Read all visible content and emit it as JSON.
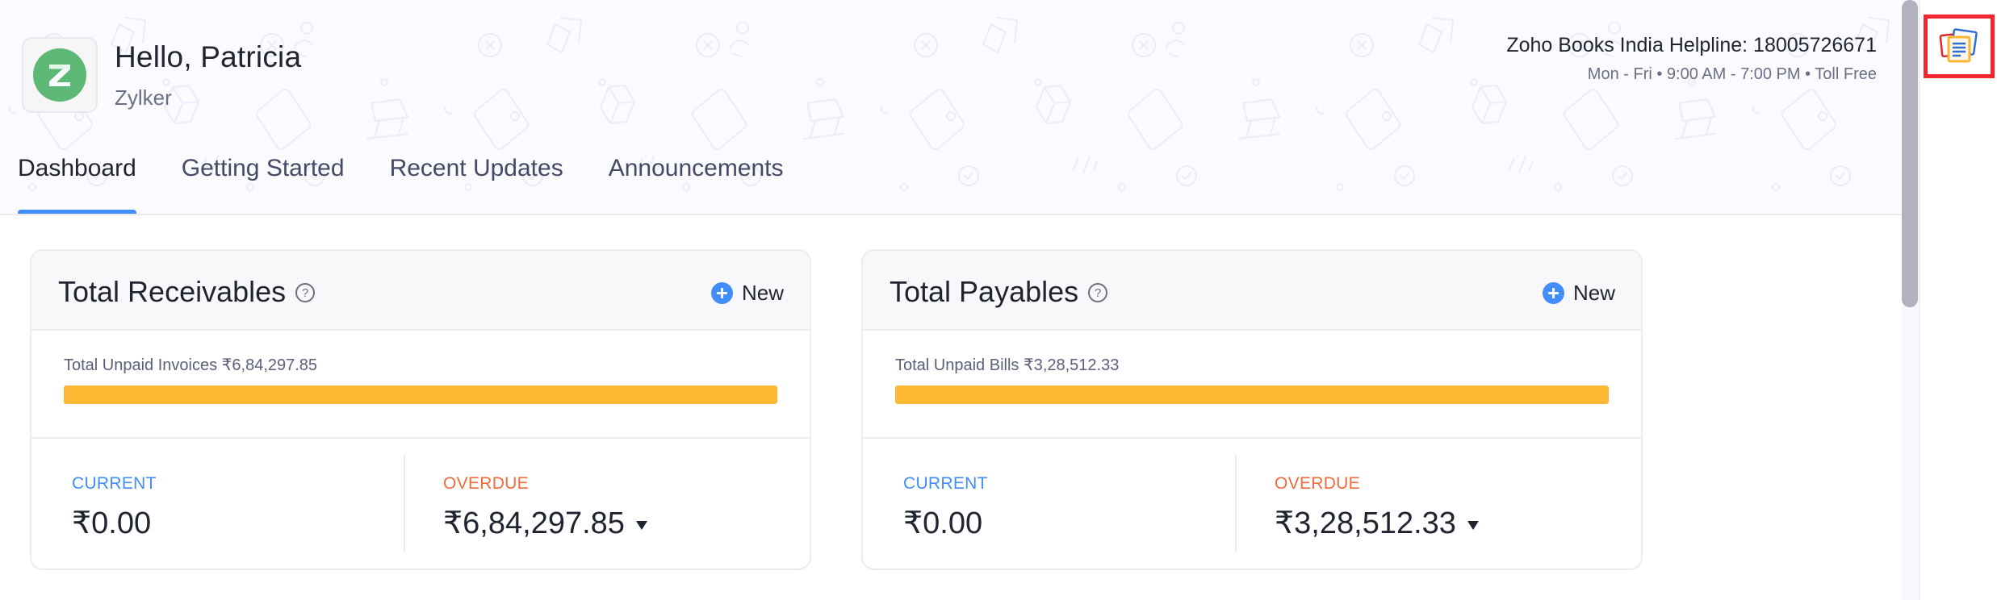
{
  "header": {
    "greeting": "Hello, Patricia",
    "organization": "Zylker",
    "logo_letter": "Z",
    "helpline_title": "Zoho Books India Helpline: 18005726671",
    "helpline_hours": "Mon - Fri • 9:00 AM - 7:00 PM • Toll Free"
  },
  "tabs": [
    {
      "label": "Dashboard",
      "active": true
    },
    {
      "label": "Getting Started",
      "active": false
    },
    {
      "label": "Recent Updates",
      "active": false
    },
    {
      "label": "Announcements",
      "active": false
    }
  ],
  "cards": {
    "receivables": {
      "title": "Total Receivables",
      "help_glyph": "?",
      "new_label": "New",
      "unpaid_text": "Total Unpaid Invoices ₹6,84,297.85",
      "overdue_fraction": 1.0,
      "current_label": "CURRENT",
      "current_amount": "₹0.00",
      "overdue_label": "OVERDUE",
      "overdue_amount": "₹6,84,297.85"
    },
    "payables": {
      "title": "Total Payables",
      "help_glyph": "?",
      "new_label": "New",
      "unpaid_text": "Total Unpaid Bills ₹3,28,512.33",
      "overdue_fraction": 1.0,
      "current_label": "CURRENT",
      "current_amount": "₹0.00",
      "overdue_label": "OVERDUE",
      "overdue_amount": "₹3,28,512.33"
    }
  },
  "colors": {
    "accent": "#408dfb",
    "current": "#408dfb",
    "overdue": "#f26a3a",
    "progress": "#fcb833",
    "logo": "#5cb874",
    "highlight": "#f2272f"
  },
  "right_panel": {
    "icon": "documents-icon"
  }
}
